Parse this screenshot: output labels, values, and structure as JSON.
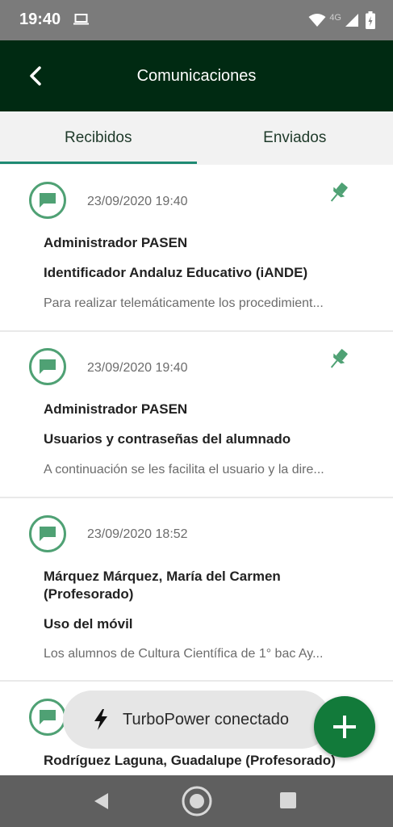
{
  "status_bar": {
    "time": "19:40",
    "network_label": "4G",
    "icons": [
      "laptop-icon",
      "wifi-icon",
      "signal-icon",
      "battery-icon"
    ]
  },
  "app_bar": {
    "title": "Comunicaciones",
    "back_icon": "back-arrow-icon",
    "background": "#002a12"
  },
  "tabs": [
    {
      "label": "Recibidos",
      "active": true
    },
    {
      "label": "Enviados",
      "active": false
    }
  ],
  "messages": [
    {
      "date": "23/09/2020 19:40",
      "sender": "Administrador PASEN",
      "subject": "Identificador Andaluz Educativo (iANDE)",
      "preview": "Para realizar telemáticamente los procedimient...",
      "pinned": true
    },
    {
      "date": "23/09/2020 19:40",
      "sender": "Administrador PASEN",
      "subject": "Usuarios y contraseñas del alumnado",
      "preview": "A continuación se les facilita el usuario y la dire...",
      "pinned": true
    },
    {
      "date": "23/09/2020 18:52",
      "sender": "Márquez Márquez, María del Carmen (Profesorado)",
      "subject": "Uso del móvil",
      "preview": "Los alumnos de Cultura Científica de 1° bac Ay...",
      "pinned": false
    },
    {
      "date": "",
      "sender": "Rodríguez Laguna, Guadalupe (Profesorado)",
      "subject": "",
      "preview": "",
      "pinned": false
    }
  ],
  "toast": {
    "text": "TurboPower conectado",
    "icon": "bolt-icon"
  },
  "fab": {
    "icon": "plus-icon",
    "color": "#127a3a"
  },
  "accent_color": "#1e8a73",
  "icon_green": "#4fa174"
}
